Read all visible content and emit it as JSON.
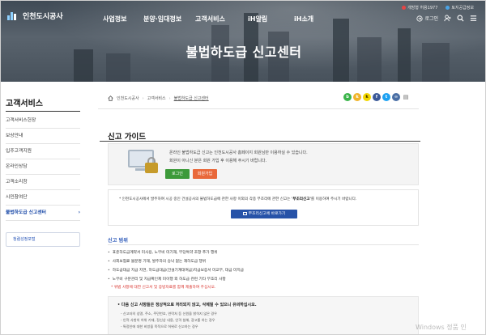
{
  "header": {
    "logo_text": "인천도시공사",
    "nav": [
      "사업정보",
      "분양·임대정보",
      "고객서비스",
      "iH알림",
      "iH소개"
    ],
    "util_links": [
      "개방형 허용1977",
      "토지공급정보"
    ],
    "login_label": "로그인"
  },
  "hero": {
    "title": "불법하도급 신고센터"
  },
  "sidebar": {
    "title": "고객서비스",
    "items": [
      {
        "label": "고객서비스헌장"
      },
      {
        "label": "보상안내"
      },
      {
        "label": "입주고객지원"
      },
      {
        "label": "온라인상담"
      },
      {
        "label": "고객소리함"
      },
      {
        "label": "시민참여단"
      },
      {
        "label": "불법하도급 신고센터",
        "active": true,
        "chevron": "›"
      }
    ],
    "banner": "청렴성정포털"
  },
  "breadcrumb": [
    "인천도시공사",
    "고객서비스",
    "불법하도급 신고센터"
  ],
  "share_icons": [
    {
      "name": "band-icon",
      "glyph": "b",
      "color": "#3bb44a"
    },
    {
      "name": "kakaostory-icon",
      "glyph": "k",
      "color": "#f0b429"
    },
    {
      "name": "kakao-icon",
      "glyph": "k",
      "color": "#f2d600"
    },
    {
      "name": "facebook-icon",
      "glyph": "f",
      "color": "#3b5998"
    },
    {
      "name": "twitter-icon",
      "glyph": "t",
      "color": "#1da1f2"
    },
    {
      "name": "url-icon",
      "glyph": "∞",
      "color": "#4a6fa5"
    },
    {
      "name": "print-icon",
      "glyph": "▤",
      "color": "#666666"
    }
  ],
  "main": {
    "heading": "신고 가이드",
    "guide": {
      "line1": "온라인 불법하도급 신고는 인천도시공사 홈페이지 회원님만 이용하실 수 있습니다.",
      "line2": "회원이 아니신 분은 회원 가입 후 이용해 주시기 바랍니다.",
      "login_button": "로그인",
      "join_button": "회원가입"
    },
    "notice": {
      "text_pre": "* 인천도시공사에서 발주하여 시공 중인 건설공사의 불법하도급에 관한 사항 이외의 각종 부조리에 관한 신고는 ",
      "text_bold": "'부조리신고'",
      "text_post": "를 이용하여 주시기 바랍니다.",
      "button": "부조리신고에 바로가기"
    },
    "scope": {
      "title": "신고 범위",
      "items": [
        "표준하도급계약서 미사용, 노무비 미기재, 부당특약 조항 추가 행위",
        "사회보험료 불분명 기재, 발주자의 승낙 없는 재하도급 행위",
        "하도급대금 지급 지연, 하도급대금(건설기계대여금)지급보증서 미교부, 대금 미지급",
        "노무비 구분관리 및 지급확인제 미이행 외 하도급 관련 기타 부조리 사항"
      ],
      "note": "* 위법 사항에 대한 신고서 및 증빙자료를 함께 제출하여 주십시오."
    },
    "bottom": {
      "title": "• 다음 신고 사항들은 정상적으로 처리되지 않고, 삭제될 수 있으니 유의하십시오.",
      "items": [
        "- 신고자의 성명, 주소, 주민번호, 연락처 등 신원을 밝히지 않은 경우",
        "- 인적 사항의 허위 기재, 정신상 내용, 인격 침해, 광고를 하는 경우",
        "- 특정인에 대한 비방을 목적으로 허위로 신고하는 경우"
      ]
    }
  },
  "watermark": "Windows 정품 인"
}
